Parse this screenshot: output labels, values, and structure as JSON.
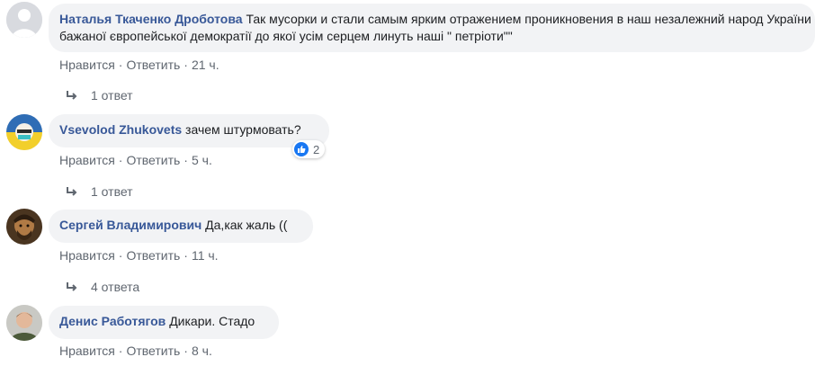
{
  "actions": {
    "like": "Нравится",
    "reply": "Ответить",
    "separator": "·"
  },
  "comments": [
    {
      "author": "Наталья Ткаченко Дроботова",
      "text": "Так мусорки и стали самым ярким отражением проникновения в наш незалежний народ України бажаної європейської демократії до якої усім серцем линуть наші \" петріоти\"\"",
      "time": "21 ч.",
      "replies": "1 ответ"
    },
    {
      "author": "Vsevolod Zhukovets",
      "text": "зачем штурмовать?",
      "time": "5 ч.",
      "replies": "1 ответ",
      "reaction_count": "2"
    },
    {
      "author": "Сергей Владимирович",
      "text": "Да,как жаль ((",
      "time": "11 ч.",
      "replies": "4 ответа"
    },
    {
      "author": "Денис Работягов",
      "text": "Дикари. Стадо",
      "time": "8 ч."
    }
  ]
}
